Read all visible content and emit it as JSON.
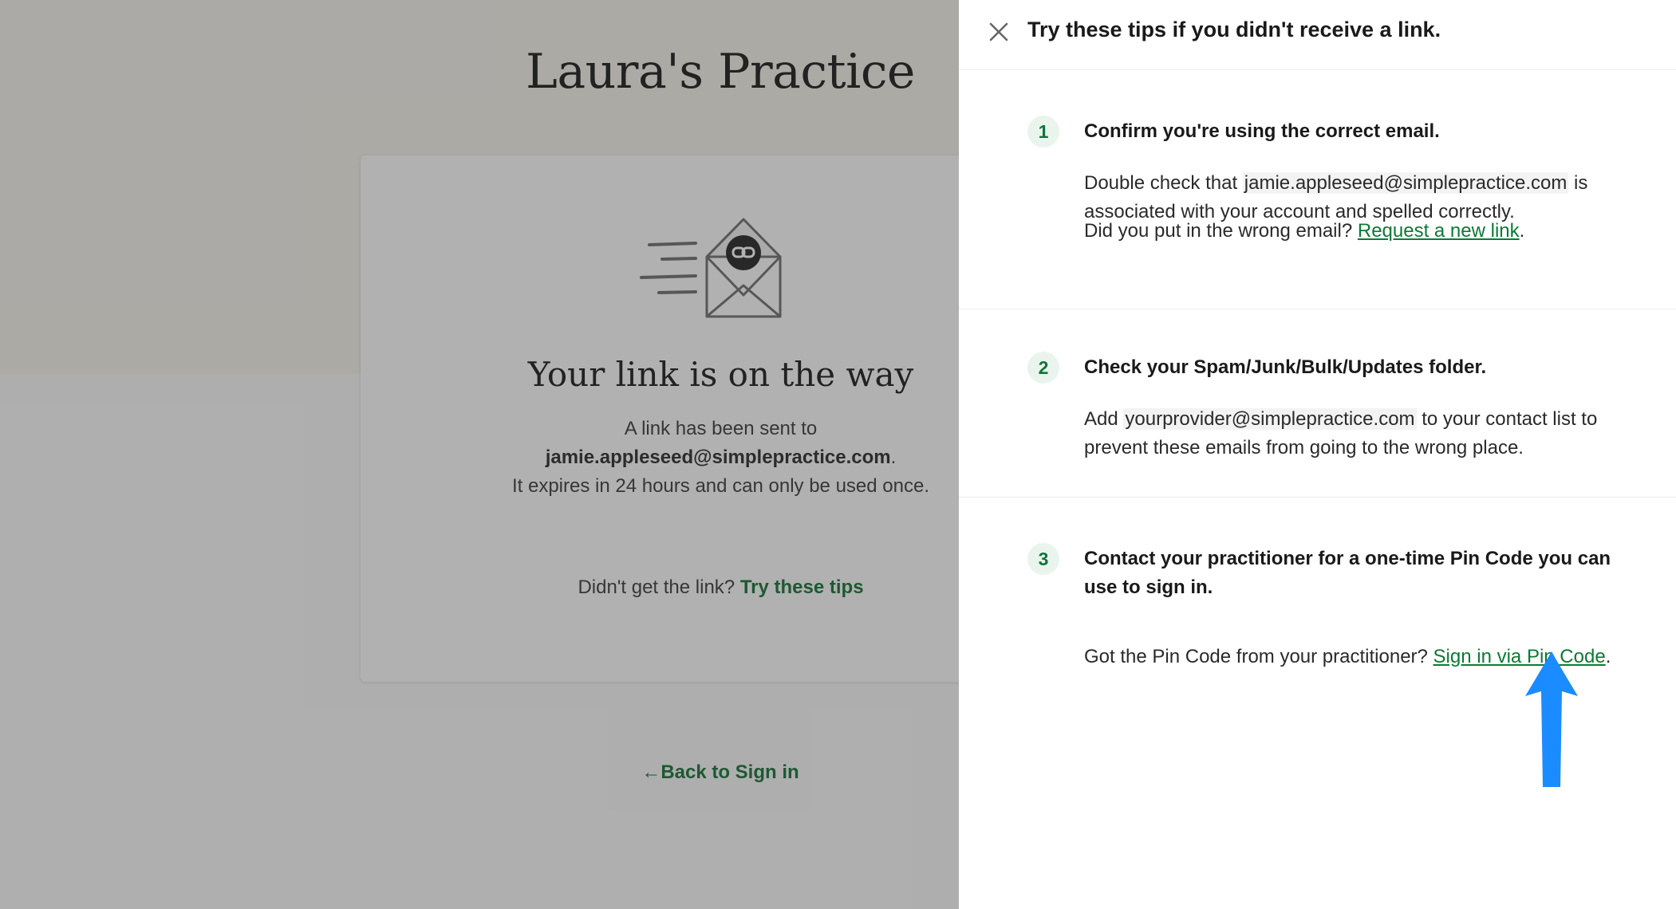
{
  "page": {
    "practice_name": "Laura's Practice",
    "card": {
      "heading": "Your link is on the way",
      "line1": "A link has been sent to",
      "email": "jamie.appleseed@simplepractice.com",
      "email_suffix": ".",
      "line3": "It expires in 24 hours and can only be used once.",
      "help_prefix": "Didn't get the link?",
      "help_link": "Try these tips"
    },
    "back_link": "Back to Sign in",
    "back_arrow": "←"
  },
  "drawer": {
    "title": "Try these tips if you didn't receive a link.",
    "tips": [
      {
        "number": "1",
        "heading": "Confirm you're using the correct email.",
        "body_prefix": "Double check that",
        "email": "jamie.appleseed@simplepractice.com",
        "body_suffix": "is associated with your account and spelled correctly.",
        "question": "Did you put in the wrong email?",
        "link": "Request a new link",
        "period": "."
      },
      {
        "number": "2",
        "heading": "Check your Spam/Junk/Bulk/Updates folder.",
        "body_prefix": "Add",
        "email": "yourprovider@simplepractice.com",
        "body_suffix": "to your contact list to prevent these emails from going to the wrong place."
      },
      {
        "number": "3",
        "heading": "Contact your practitioner for a one-time Pin Code you can use to sign in.",
        "question": "Got the Pin Code from your practitioner?",
        "link": "Sign in via Pin Code",
        "period": "."
      }
    ]
  },
  "icons": [
    "envelope-link-icon",
    "close-icon",
    "back-arrow-icon",
    "pointer-arrow-annotation"
  ],
  "colors": {
    "link_green": "#0b7a35",
    "step_badge_bg": "#e9f5ec",
    "annotation_blue": "#1a8cff"
  }
}
